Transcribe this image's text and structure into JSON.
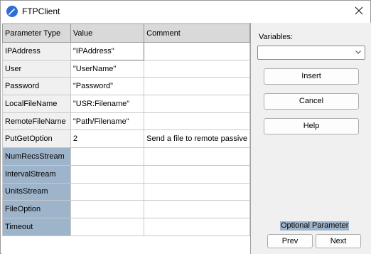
{
  "window": {
    "title": "FTPClient",
    "app_icon": "ftp-app-icon",
    "close_icon": "close-icon"
  },
  "grid": {
    "headers": [
      "Parameter Type",
      "Value",
      "Comment"
    ],
    "rows": [
      {
        "type": "IPAddress",
        "value": "\"IPAddress\"",
        "comment": "",
        "optional": false
      },
      {
        "type": "User",
        "value": "\"UserName\"",
        "comment": "",
        "optional": false
      },
      {
        "type": "Password",
        "value": "\"Password\"",
        "comment": "",
        "optional": false
      },
      {
        "type": "LocalFileName",
        "value": "\"USR:Filename\"",
        "comment": "",
        "optional": false
      },
      {
        "type": "RemoteFileName",
        "value": "\"Path/Filename\"",
        "comment": "",
        "optional": false
      },
      {
        "type": "PutGetOption",
        "value": "2",
        "comment": "Send a file to remote passive",
        "optional": false
      },
      {
        "type": "NumRecsStream",
        "value": "",
        "comment": "",
        "optional": true
      },
      {
        "type": "IntervalStream",
        "value": "",
        "comment": "",
        "optional": true
      },
      {
        "type": "UnitsStream",
        "value": "",
        "comment": "",
        "optional": true
      },
      {
        "type": "FileOption",
        "value": "",
        "comment": "",
        "optional": true
      },
      {
        "type": "Timeout",
        "value": "",
        "comment": "",
        "optional": true
      }
    ]
  },
  "side": {
    "variables_label": "Variables:",
    "variables_value": "",
    "insert": "Insert",
    "cancel": "Cancel",
    "help": "Help",
    "optional_parameter": "Optional Parameter",
    "prev": "Prev",
    "next": "Next"
  },
  "colors": {
    "optional_highlight": "#9eb4cb",
    "header_bg": "#d9d9d9"
  }
}
